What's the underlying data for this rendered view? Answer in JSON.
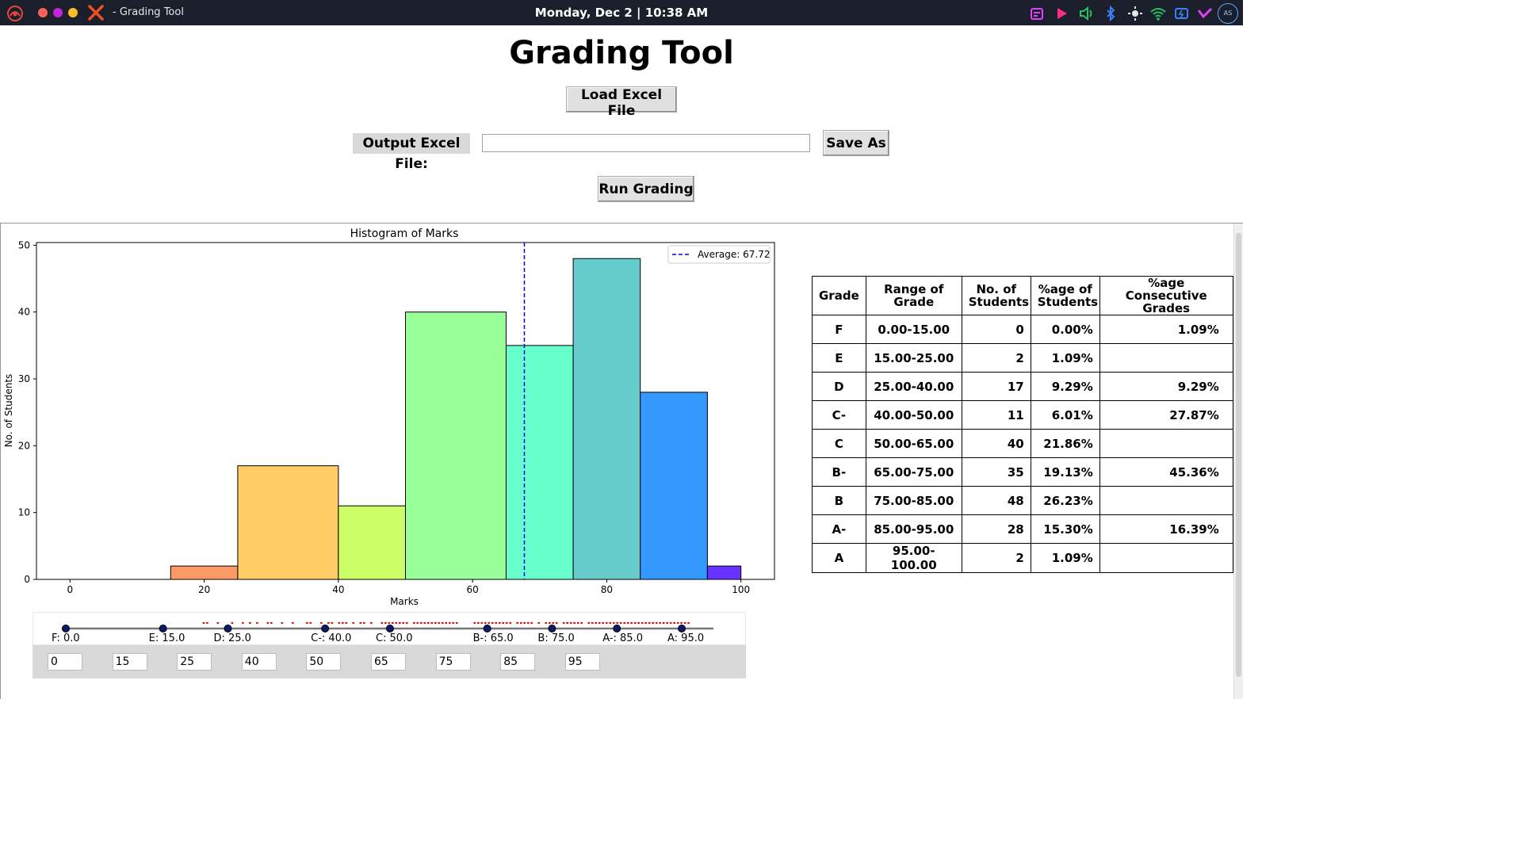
{
  "topbar": {
    "window_title": "- Grading Tool",
    "clock": "Monday, Dec 2 | 10:38 AM",
    "avatar_initials": "AS",
    "icons": [
      "app-menu-icon",
      "close-x-icon",
      "calendar-icon",
      "media-play-icon",
      "volume-icon",
      "bluetooth-icon",
      "brightness-icon",
      "wifi-icon",
      "battery-icon",
      "vpn-icon",
      "avatar-icon"
    ]
  },
  "app": {
    "title": "Grading Tool",
    "load_button": "Load Excel File",
    "output_label": "Output Excel File:",
    "output_value": "",
    "save_button": "Save As",
    "run_button": "Run Grading"
  },
  "chart_data": {
    "type": "bar",
    "title": "Histogram of Marks",
    "xlabel": "Marks",
    "ylabel": "No. of Students",
    "xlim": [
      -5,
      105
    ],
    "ylim": [
      0,
      50.4
    ],
    "xticks": [
      0,
      20,
      40,
      60,
      80,
      100
    ],
    "yticks": [
      0,
      10,
      20,
      30,
      40,
      50
    ],
    "bins": [
      {
        "from": 0,
        "to": 15,
        "value": 0,
        "color": "#8000ff"
      },
      {
        "from": 15,
        "to": 25,
        "value": 2,
        "color": "#ff9966"
      },
      {
        "from": 25,
        "to": 40,
        "value": 17,
        "color": "#ffcc66"
      },
      {
        "from": 40,
        "to": 50,
        "value": 11,
        "color": "#ccff66"
      },
      {
        "from": 50,
        "to": 65,
        "value": 40,
        "color": "#99ff99"
      },
      {
        "from": 65,
        "to": 75,
        "value": 35,
        "color": "#66ffcc"
      },
      {
        "from": 75,
        "to": 85,
        "value": 48,
        "color": "#66cccc"
      },
      {
        "from": 85,
        "to": 95,
        "value": 28,
        "color": "#3399ff"
      },
      {
        "from": 95,
        "to": 100,
        "value": 2,
        "color": "#6633ff"
      }
    ],
    "average": {
      "value": 67.72,
      "label": "Average: 67.72",
      "color": "#0000ee"
    },
    "legend_position": "top-right"
  },
  "table": {
    "headers": [
      "Grade",
      "Range of Grade",
      "No. of Students",
      "%age of Students",
      "%age Consecutive Grades"
    ],
    "rows": [
      [
        "F",
        "0.00-15.00",
        "0",
        "0.00%",
        "1.09%"
      ],
      [
        "E",
        "15.00-25.00",
        "2",
        "1.09%",
        ""
      ],
      [
        "D",
        "25.00-40.00",
        "17",
        "9.29%",
        "9.29%"
      ],
      [
        "C-",
        "40.00-50.00",
        "11",
        "6.01%",
        "27.87%"
      ],
      [
        "C",
        "50.00-65.00",
        "40",
        "21.86%",
        ""
      ],
      [
        "B-",
        "65.00-75.00",
        "35",
        "19.13%",
        "45.36%"
      ],
      [
        "B",
        "75.00-85.00",
        "48",
        "26.23%",
        ""
      ],
      [
        "A-",
        "85.00-95.00",
        "28",
        "15.30%",
        "16.39%"
      ],
      [
        "A",
        "95.00-100.00",
        "2",
        "1.09%",
        ""
      ]
    ]
  },
  "slider": {
    "thresholds": [
      {
        "label": "F: 0.0",
        "value": 0,
        "input": "0"
      },
      {
        "label": "E: 15.0",
        "value": 15,
        "input": "15"
      },
      {
        "label": "D: 25.0",
        "value": 25,
        "input": "25"
      },
      {
        "label": "C-: 40.0",
        "value": 40,
        "input": "40"
      },
      {
        "label": "C: 50.0",
        "value": 50,
        "input": "50"
      },
      {
        "label": "B-: 65.0",
        "value": 65,
        "input": "65"
      },
      {
        "label": "B: 75.0",
        "value": 75,
        "input": "75"
      },
      {
        "label": "A-: 85.0",
        "value": 85,
        "input": "85"
      },
      {
        "label": "A: 95.0",
        "value": 95,
        "input": "95"
      }
    ],
    "marks_marker_color": "#ff0000",
    "marks_shown_range": [
      20,
      96
    ]
  }
}
